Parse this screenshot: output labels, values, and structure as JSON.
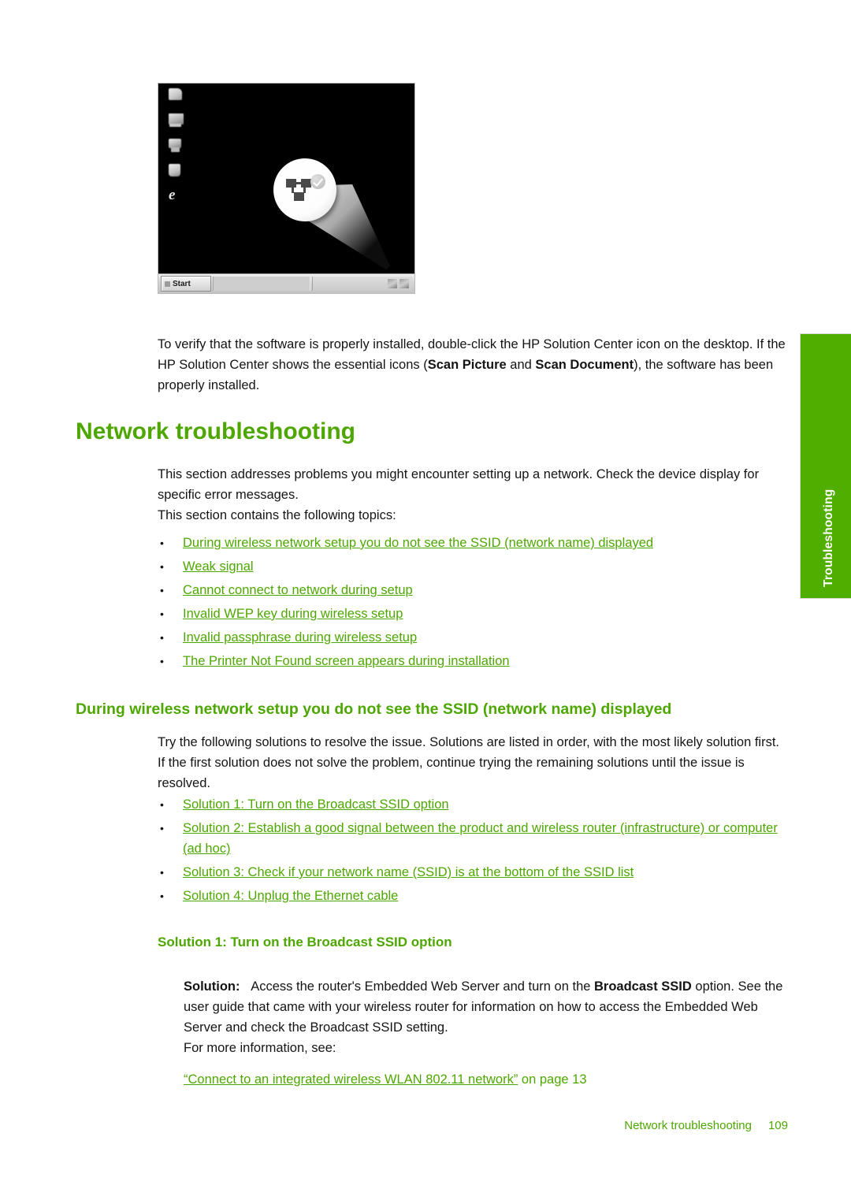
{
  "figure": {
    "name": "windows-desktop-screenshot",
    "desktop_icons": [
      "my-documents-icon",
      "my-computer-icon",
      "my-network-places-icon",
      "recycle-bin-icon",
      "internet-explorer-icon"
    ],
    "callout": {
      "magnified_icon": "network-connection-tray-icon",
      "badge": "check-mark-badge"
    },
    "taskbar": {
      "start_label": "Start",
      "tray_icons": [
        "tray-icon-1",
        "tray-icon-2"
      ]
    }
  },
  "intro": {
    "paragraph_part1": "To verify that the software is properly installed, double-click the HP Solution Center icon on the desktop. If the HP Solution Center shows the essential icons (",
    "bold1": "Scan Picture",
    "paragraph_part2": " and ",
    "bold2": "Scan Document",
    "paragraph_part3": "), the software has been properly installed."
  },
  "section": {
    "heading": "Network troubleshooting",
    "paragraph1": "This section addresses problems you might encounter setting up a network. Check the device display for specific error messages.",
    "paragraph2": "This section contains the following topics:",
    "topics": [
      "During wireless network setup you do not see the SSID (network name) displayed",
      "Weak signal",
      "Cannot connect to network during setup",
      "Invalid WEP key during wireless setup",
      "Invalid passphrase during wireless setup",
      "The Printer Not Found screen appears during installation"
    ]
  },
  "subsection": {
    "heading": "During wireless network setup you do not see the SSID (network name) displayed",
    "paragraph": "Try the following solutions to resolve the issue. Solutions are listed in order, with the most likely solution first. If the first solution does not solve the problem, continue trying the remaining solutions until the issue is resolved.",
    "solutions": [
      "Solution 1: Turn on the Broadcast SSID option",
      "Solution 2: Establish a good signal between the product and wireless router (infrastructure) or computer (ad hoc)",
      "Solution 3: Check if your network name (SSID) is at the bottom of the SSID list",
      "Solution 4: Unplug the Ethernet cable"
    ]
  },
  "solution1": {
    "heading": "Solution 1: Turn on the Broadcast SSID option",
    "label": "Solution:",
    "text_part1": "Access the router's Embedded Web Server and turn on the ",
    "bold1": "Broadcast SSID",
    "text_part2": " option. See the user guide that came with your wireless router for information on how to access the Embedded Web Server and check the Broadcast SSID setting.",
    "more_info": "For more information, see:",
    "reference_link": "“Connect to an integrated wireless WLAN 802.11 network”",
    "reference_suffix": " on page 13"
  },
  "side_tab": {
    "label": "Troubleshooting",
    "color": "#4fae00"
  },
  "footer": {
    "title": "Network troubleshooting",
    "page": "109",
    "color": "#4da700"
  }
}
